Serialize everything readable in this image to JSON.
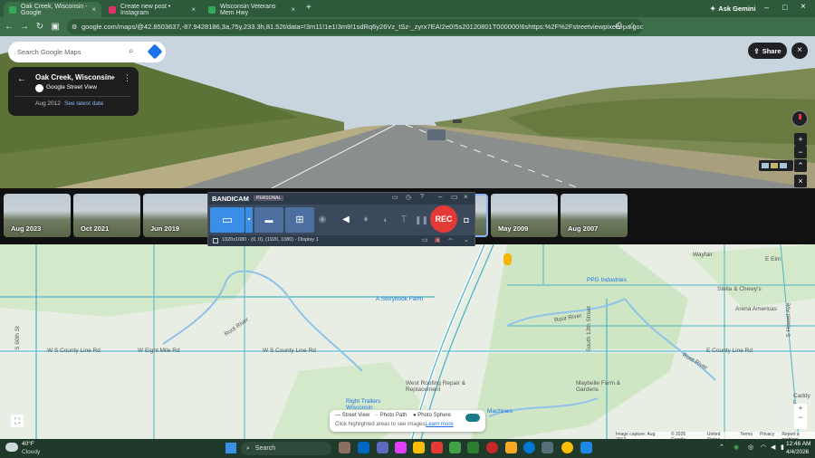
{
  "browser": {
    "tabs": [
      {
        "title": "Oak Creek, Wisconsin - Google",
        "color": "#34a853"
      },
      {
        "title": "Create new post • Instagram",
        "color": "#e1306c"
      },
      {
        "title": "Wisconsin Veterans Mem Hwy",
        "color": "#34a853"
      }
    ],
    "ask_gemini": "Ask Gemini",
    "url": "google.com/maps/@42.8503637,-87.9428186,3a,75y,233.3h,81.52t/data=!3m11!1e1!3m9!1sdRq6y26Vz_tSz-_zyrx7EA!2e0!5s20120801T000000!6shttps:%2F%2Fstreetviewpixels-pa.googleapis.com%2Fv..."
  },
  "maps": {
    "search_placeholder": "Search Google Maps",
    "share": "Share",
    "place_title": "Oak Creek, Wisconsin",
    "place_subtitle": "Google Street View",
    "capture_date": "Aug 2012",
    "see_latest": "See latest date"
  },
  "filmstrip": {
    "thumbs": [
      "Aug 2023",
      "Oct 2021",
      "Jun 2019",
      "May 2009",
      "Aug 2007"
    ]
  },
  "bandicam": {
    "brand": "BANDICAM",
    "edition": "PERSONAL",
    "rec": "REC",
    "mode_label": "1920x1080 - (0, 0), (1920, 1080) - Display 1"
  },
  "map_labels": {
    "storybook": "A Storybook Farm",
    "ppg": "PPG Industries",
    "stella": "Stella & Chewy's",
    "arena": "Arena Americas",
    "wayfair": "Wayfair",
    "west_roofing": "West Roofing Repair & Replacement",
    "right_trailers": "Right Trailers Wisconsin",
    "maybelle": "Maybelle Farm & Gardens",
    "machines": "Machines",
    "eight_mile": "W Eight Mile Rd",
    "county_line_1": "W S County Line Rd",
    "county_line_2": "W S County Line Rd",
    "county_line_3": "E County Line Rd",
    "root_river_1": "Root River",
    "root_river_2": "Root River",
    "root_river_3": "Root River",
    "s60th": "S 60th St",
    "s13th": "South 13th Street",
    "s_howell": "S Howell Ave",
    "caddy": "Caddy L",
    "e_elm": "E Elm"
  },
  "legend": {
    "street_view": "Street View",
    "photo_path": "Photo Path",
    "photo_sphere": "Photo Sphere",
    "hint": "Click highlighted areas to see images.",
    "learn_more": "Learn more"
  },
  "attribution": [
    "Image capture: Aug 2012",
    "© 2026 Google",
    "United States",
    "Terms",
    "Privacy",
    "Report a problem"
  ],
  "taskbar": {
    "temp": "40°F",
    "weather": "Cloudy",
    "search": "Search",
    "time": "12:46 AM",
    "date": "4/4/2026"
  }
}
